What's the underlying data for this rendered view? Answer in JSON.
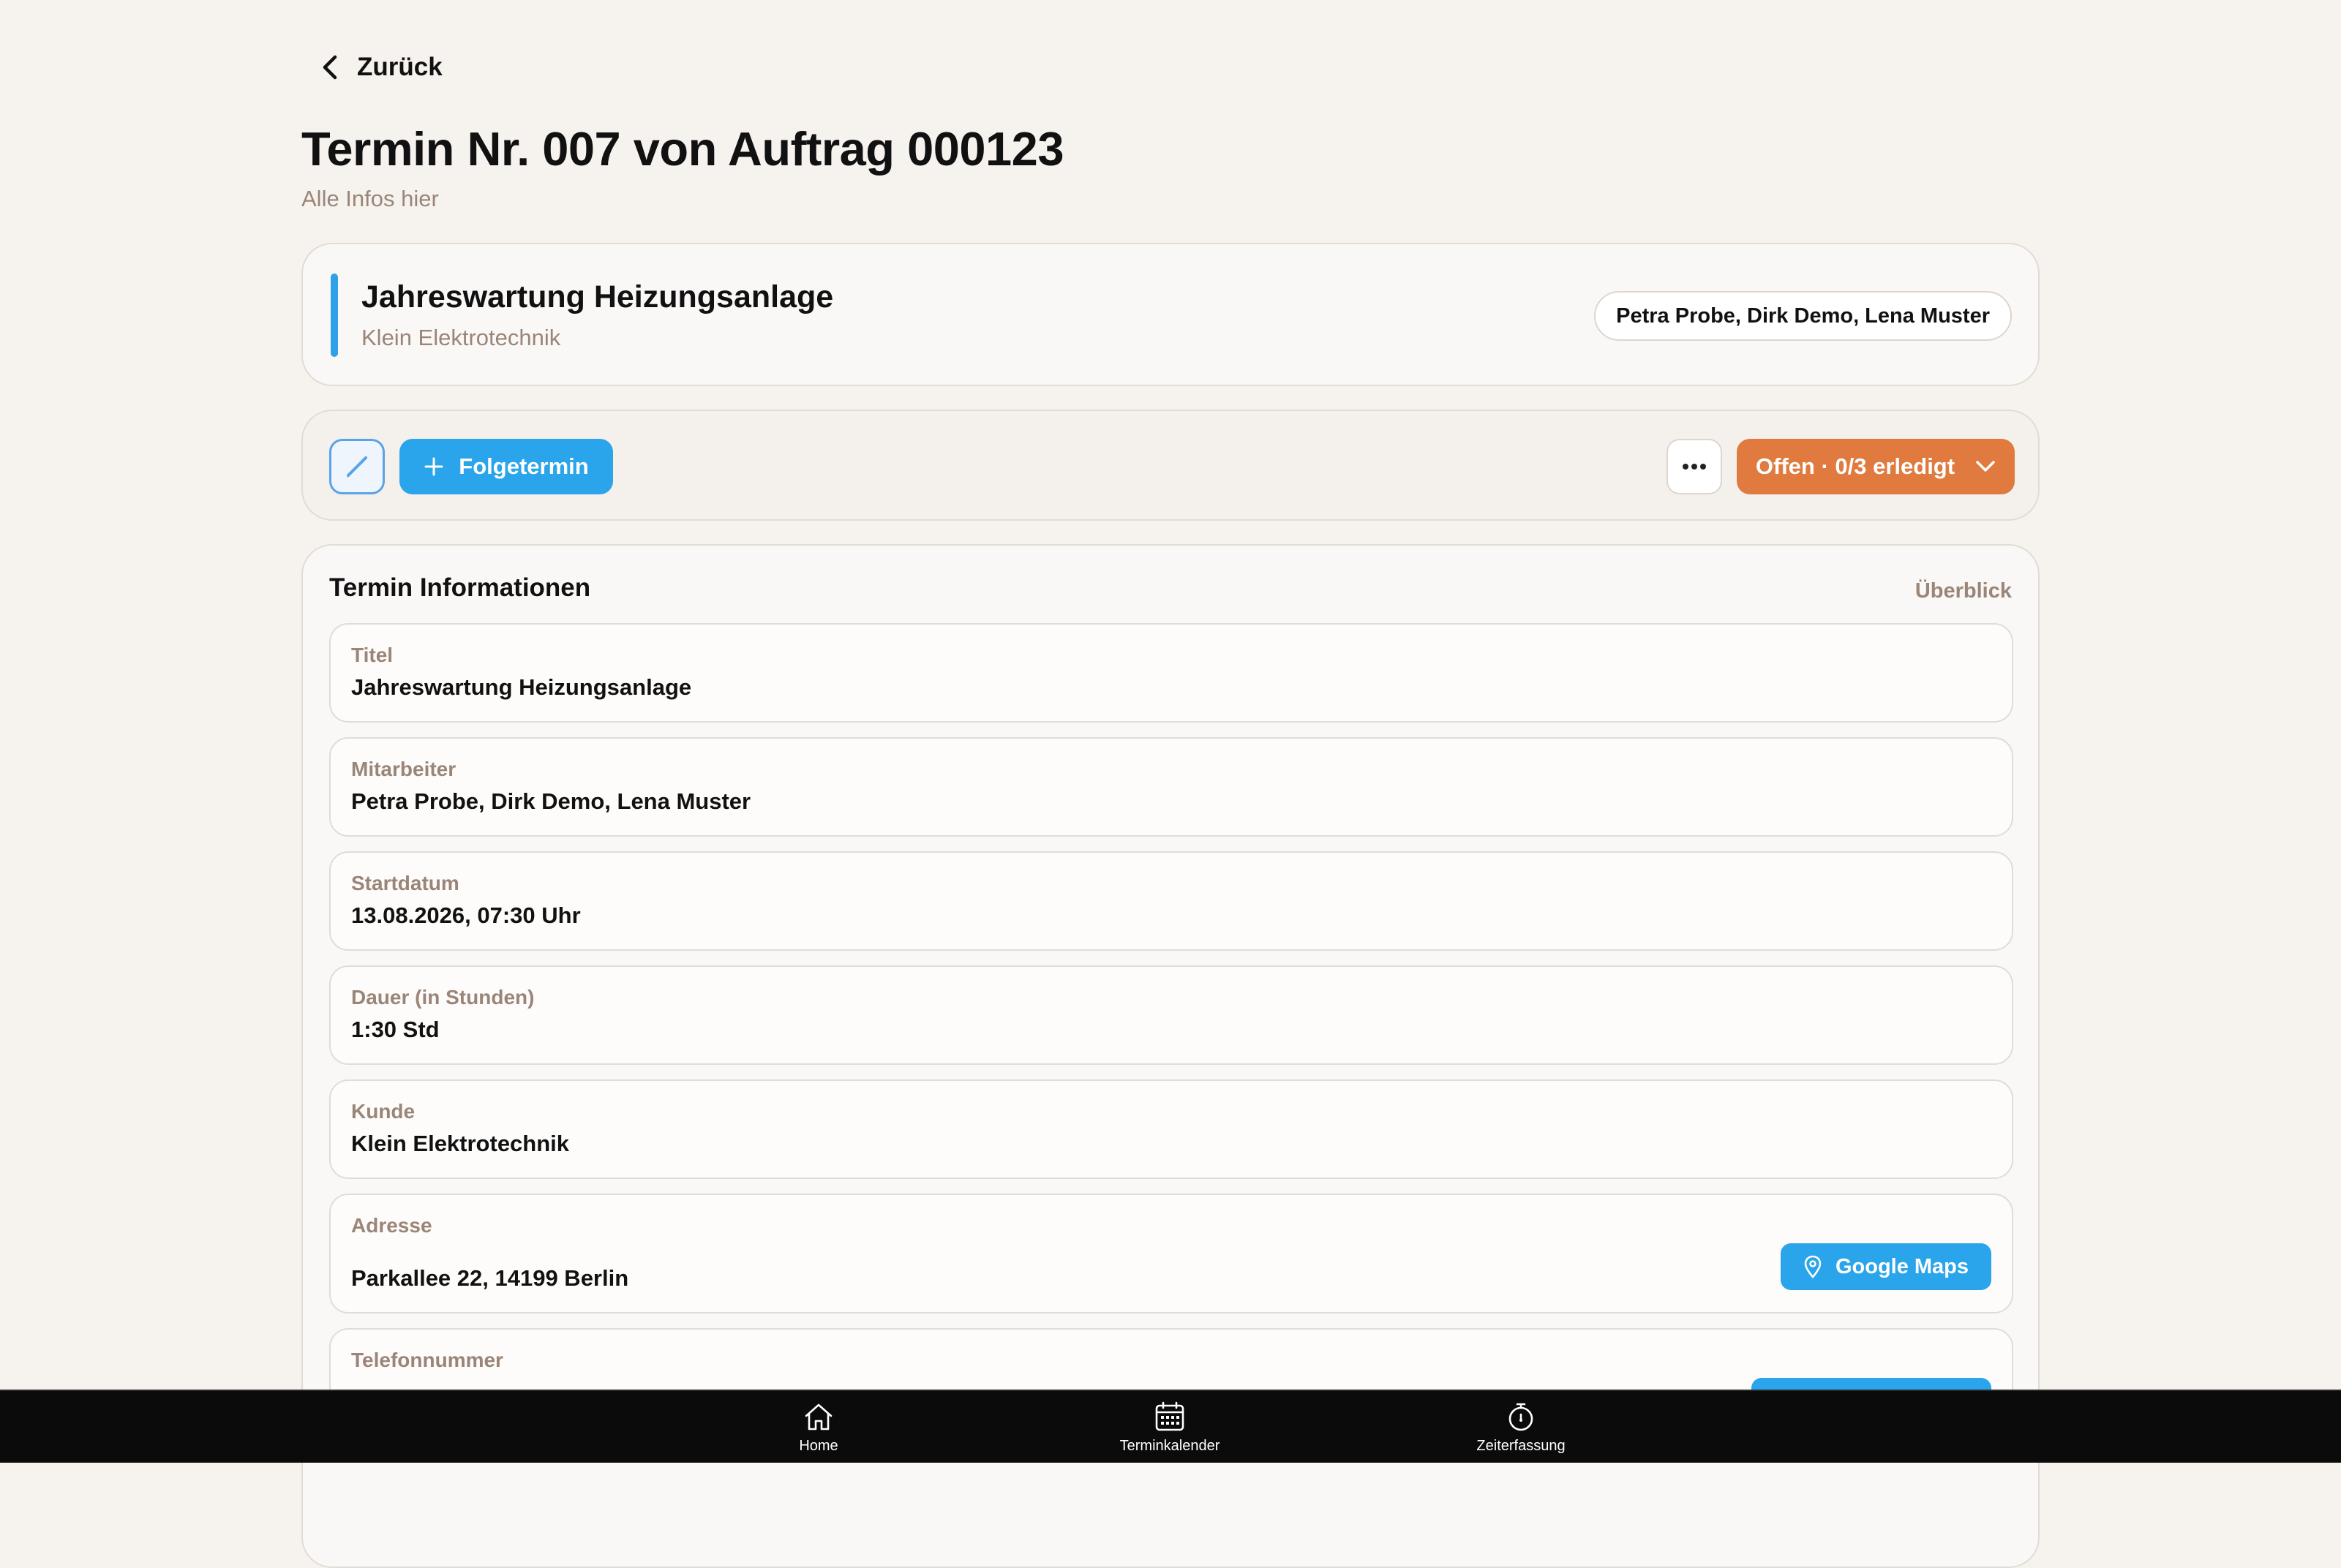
{
  "header": {
    "back_label": "Zurück",
    "title": "Termin Nr. 007 von Auftrag 000123",
    "subtitle": "Alle Infos hier"
  },
  "summary": {
    "title": "Jahreswartung Heizungsanlage",
    "customer": "Klein Elektrotechnik",
    "employees_chip": "Petra Probe, Dirk Demo, Lena Muster",
    "accent_color": "#2fa1e8"
  },
  "actions": {
    "follow_label": "Folgetermin",
    "status_label": "Offen · 0/3 erledigt",
    "status_color": "#e07a3e",
    "primary_color": "#2aa4ea"
  },
  "info": {
    "title": "Termin Informationen",
    "overview_link": "Überblick",
    "fields": [
      {
        "label": "Titel",
        "value": "Jahreswartung Heizungsanlage"
      },
      {
        "label": "Mitarbeiter",
        "value": "Petra Probe, Dirk Demo, Lena Muster"
      },
      {
        "label": "Startdatum",
        "value": "13.08.2026, 07:30 Uhr"
      },
      {
        "label": "Dauer (in Stunden)",
        "value": "1:30 Std"
      },
      {
        "label": "Kunde",
        "value": "Klein Elektrotechnik"
      },
      {
        "label": "Adresse",
        "value": "Parkallee 22, 14199 Berlin",
        "button": "Google Maps"
      },
      {
        "label": "Telefonnummer",
        "value": ""
      }
    ]
  },
  "nav": {
    "items": [
      {
        "label": "Home",
        "icon": "home-icon"
      },
      {
        "label": "Terminkalender",
        "icon": "calendar-icon"
      },
      {
        "label": "Zeiterfassung",
        "icon": "stopwatch-icon"
      }
    ]
  }
}
